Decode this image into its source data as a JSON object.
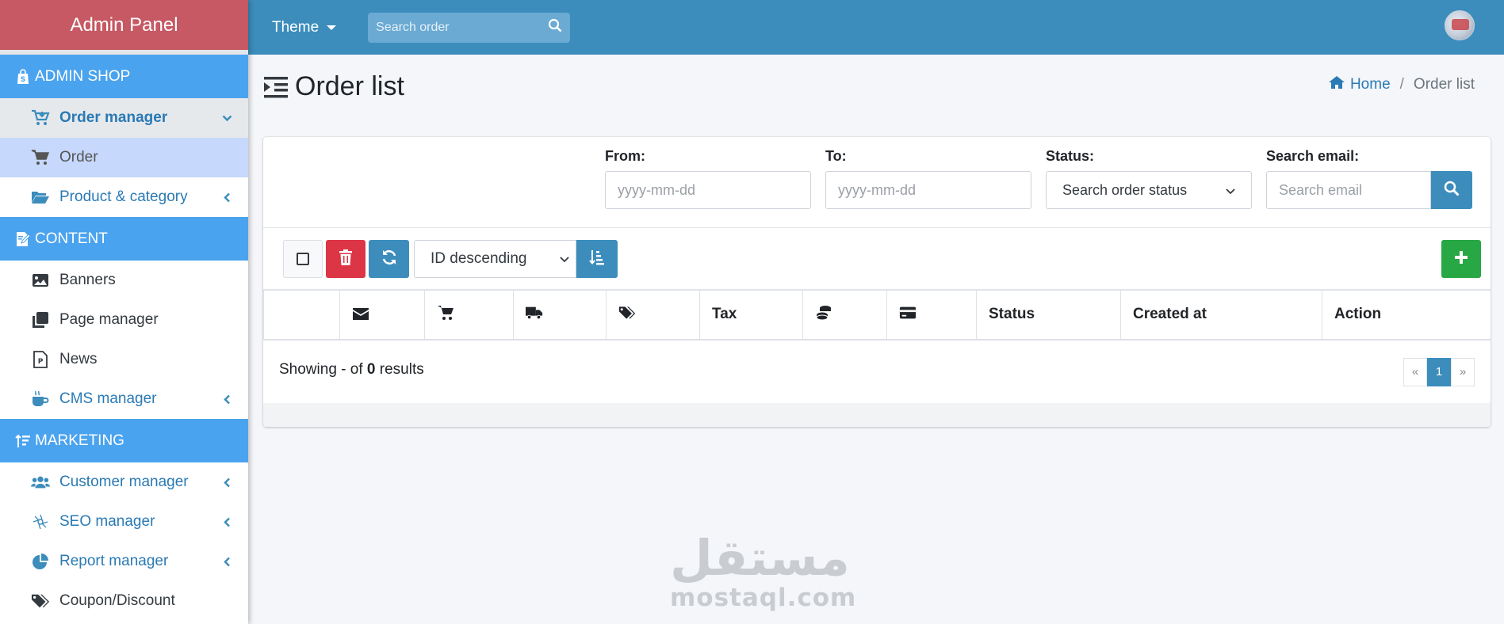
{
  "sidebar": {
    "brand": "Admin Panel",
    "sections": [
      {
        "title": "ADMIN SHOP",
        "icon": "shopify-bag-icon"
      },
      {
        "title": "CONTENT",
        "icon": "edit-document-icon"
      },
      {
        "title": "MARKETING",
        "icon": "sort-amount-icon"
      }
    ],
    "items": [
      {
        "label": "Order manager",
        "icon": "cart-download-icon",
        "state": "open"
      },
      {
        "label": "Order",
        "icon": "cart-icon",
        "state": "active"
      },
      {
        "label": "Product & category",
        "icon": "folder-open-icon"
      },
      {
        "label": "Banners",
        "icon": "image-icon"
      },
      {
        "label": "Page manager",
        "icon": "clone-icon"
      },
      {
        "label": "News",
        "icon": "file-powerpoint-icon"
      },
      {
        "label": "CMS manager",
        "icon": "coffee-icon"
      },
      {
        "label": "Customer manager",
        "icon": "users-icon"
      },
      {
        "label": "SEO manager",
        "icon": "seo-icon"
      },
      {
        "label": "Report manager",
        "icon": "pie-chart-icon"
      },
      {
        "label": "Coupon/Discount",
        "icon": "tags-icon"
      }
    ]
  },
  "topbar": {
    "theme_label": "Theme",
    "search_placeholder": "Search order"
  },
  "header": {
    "title": "Order list",
    "breadcrumb": {
      "home": "Home",
      "current": "Order list",
      "separator": "/"
    }
  },
  "filters": {
    "from_label": "From:",
    "from_placeholder": "yyyy-mm-dd",
    "to_label": "To:",
    "to_placeholder": "yyyy-mm-dd",
    "status_label": "Status:",
    "status_value": "Search order status",
    "email_label": "Search email:",
    "email_placeholder": "Search email"
  },
  "toolbar": {
    "sort_value": "ID descending"
  },
  "table": {
    "columns": [
      {
        "label": "",
        "icon": ""
      },
      {
        "label": "",
        "icon": "envelope-icon"
      },
      {
        "label": "",
        "icon": "cart-icon"
      },
      {
        "label": "",
        "icon": "truck-icon"
      },
      {
        "label": "",
        "icon": "tags-icon"
      },
      {
        "label": "Tax",
        "icon": ""
      },
      {
        "label": "",
        "icon": "coins-icon"
      },
      {
        "label": "",
        "icon": "credit-card-icon"
      },
      {
        "label": "Status",
        "icon": ""
      },
      {
        "label": "Created at",
        "icon": ""
      },
      {
        "label": "Action",
        "icon": ""
      }
    ]
  },
  "results": {
    "prefix": "Showing - of",
    "count": "0",
    "suffix": "results"
  },
  "pagination": {
    "prev": "«",
    "current": "1",
    "next": "»"
  },
  "watermark": {
    "arabic": "مستقل",
    "latin": "mostaql.com"
  },
  "colors": {
    "brand_bg": "#c65963",
    "topbar_bg": "#3c8dbc",
    "section_bg": "#4aa3ee",
    "active_bg": "#c6d8fb",
    "danger": "#dc3545",
    "success": "#28a745",
    "link": "#2a7ab5"
  }
}
